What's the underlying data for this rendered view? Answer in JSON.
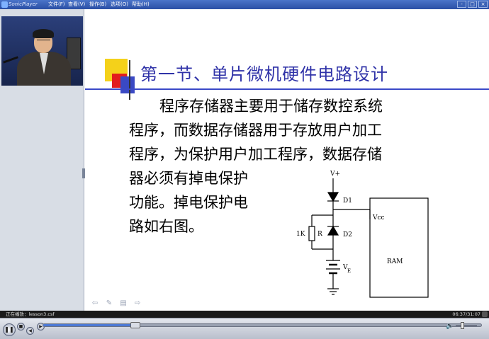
{
  "window": {
    "app_title": "SonicPlayer",
    "menu": [
      "文件(F)",
      "查看(V)",
      "操作(B)",
      "选项(O)",
      "帮助(H)"
    ],
    "buttons": [
      "-",
      "□",
      "×"
    ]
  },
  "slide": {
    "title": "第一节、单片微机硬件电路设计",
    "lines": [
      "程序存储器主要用于储存数控系统",
      "程序，而数据存储器用于存放用户加工",
      "程序，为保护用户加工程序，数据存储",
      "器必须有掉电保护",
      "功能。掉电保护电",
      "路如右图。"
    ],
    "circuit_labels": {
      "vplus": "V+",
      "d1": "D1",
      "d2": "D2",
      "r_value": "1K",
      "r": "R",
      "vcc": "Vcc",
      "ram": "RAM",
      "vb": "V",
      "vb_sub": "E"
    },
    "nav_icons": [
      "back-arrow-icon",
      "pen-icon",
      "menu-icon",
      "forward-arrow-icon"
    ]
  },
  "status": {
    "left": "正在播放：lesson3.csf",
    "time": "06:37/31:07"
  },
  "player": {
    "progress": 0.21,
    "volume": 0.3
  }
}
